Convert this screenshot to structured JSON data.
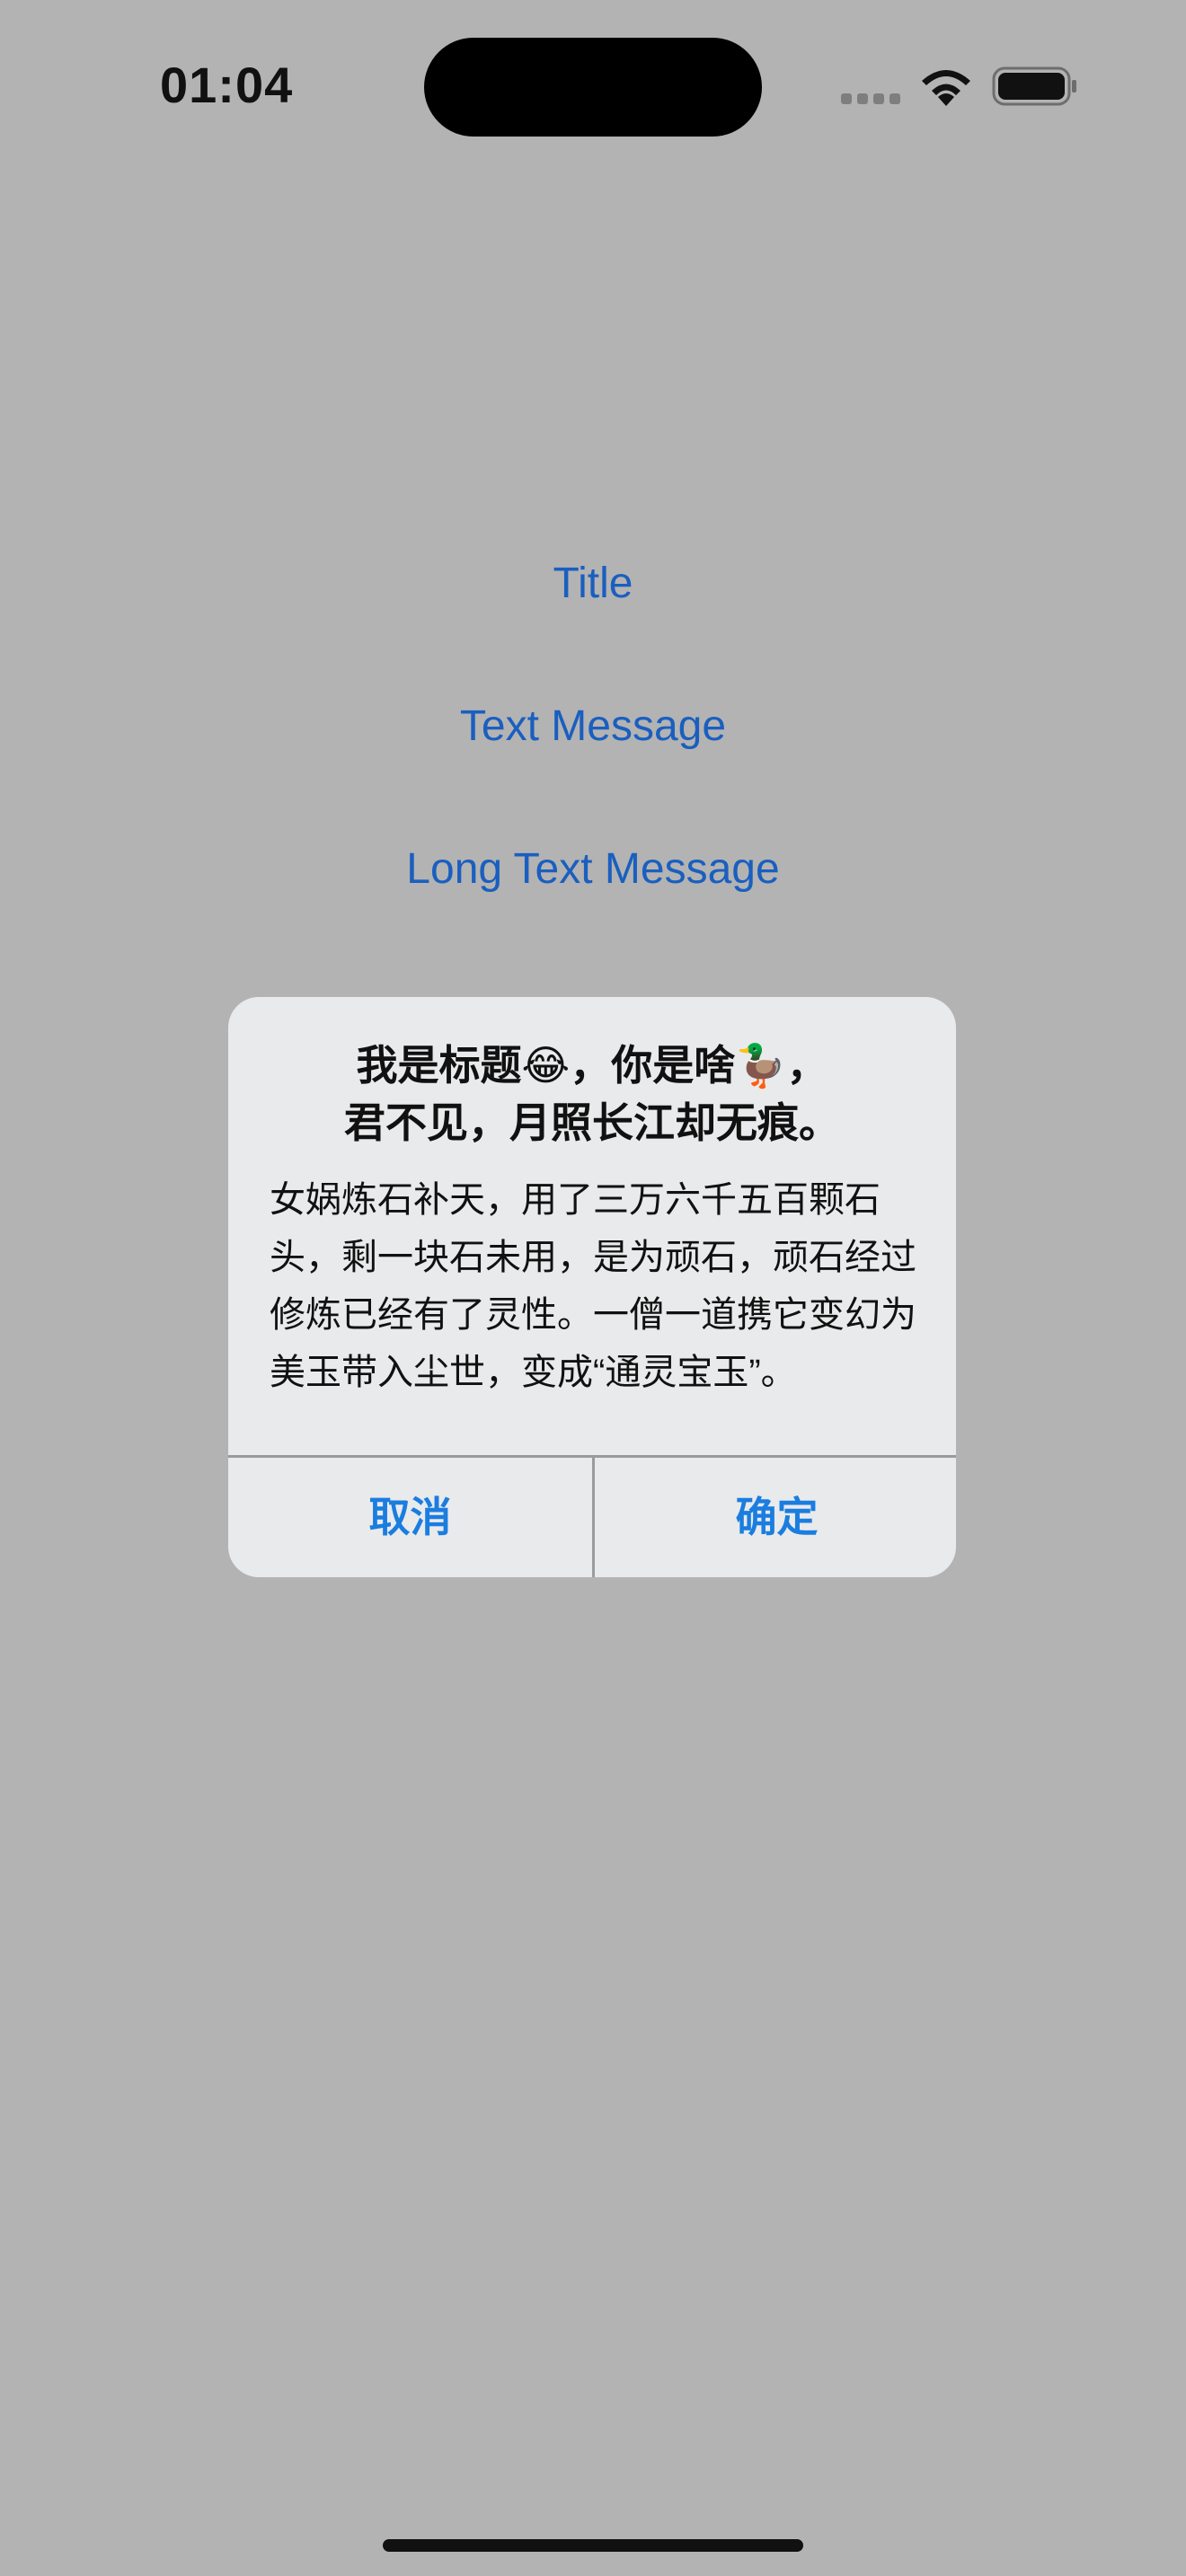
{
  "status_bar": {
    "time": "01:04"
  },
  "menu": {
    "items": [
      {
        "label": "Title"
      },
      {
        "label": "Text Message"
      },
      {
        "label": "Long Text Message"
      }
    ]
  },
  "alert": {
    "title_line1": "我是标题😂，你是啥🦆，",
    "title_line2": "君不见，月照长江却无痕。",
    "message": "女娲炼石补天，用了三万六千五百颗石头，剩一块石未用，是为顽石，顽石经过修炼已经有了灵性。一僧一道携它变幻为美玉带入尘世，变成“通灵宝玉”。",
    "cancel_label": "取消",
    "confirm_label": "确定"
  },
  "colors": {
    "background": "#b3b3b3",
    "menu_text": "#1a5fbf",
    "button_text": "#1a7de0",
    "alert_bg": "#e9eaeb"
  }
}
